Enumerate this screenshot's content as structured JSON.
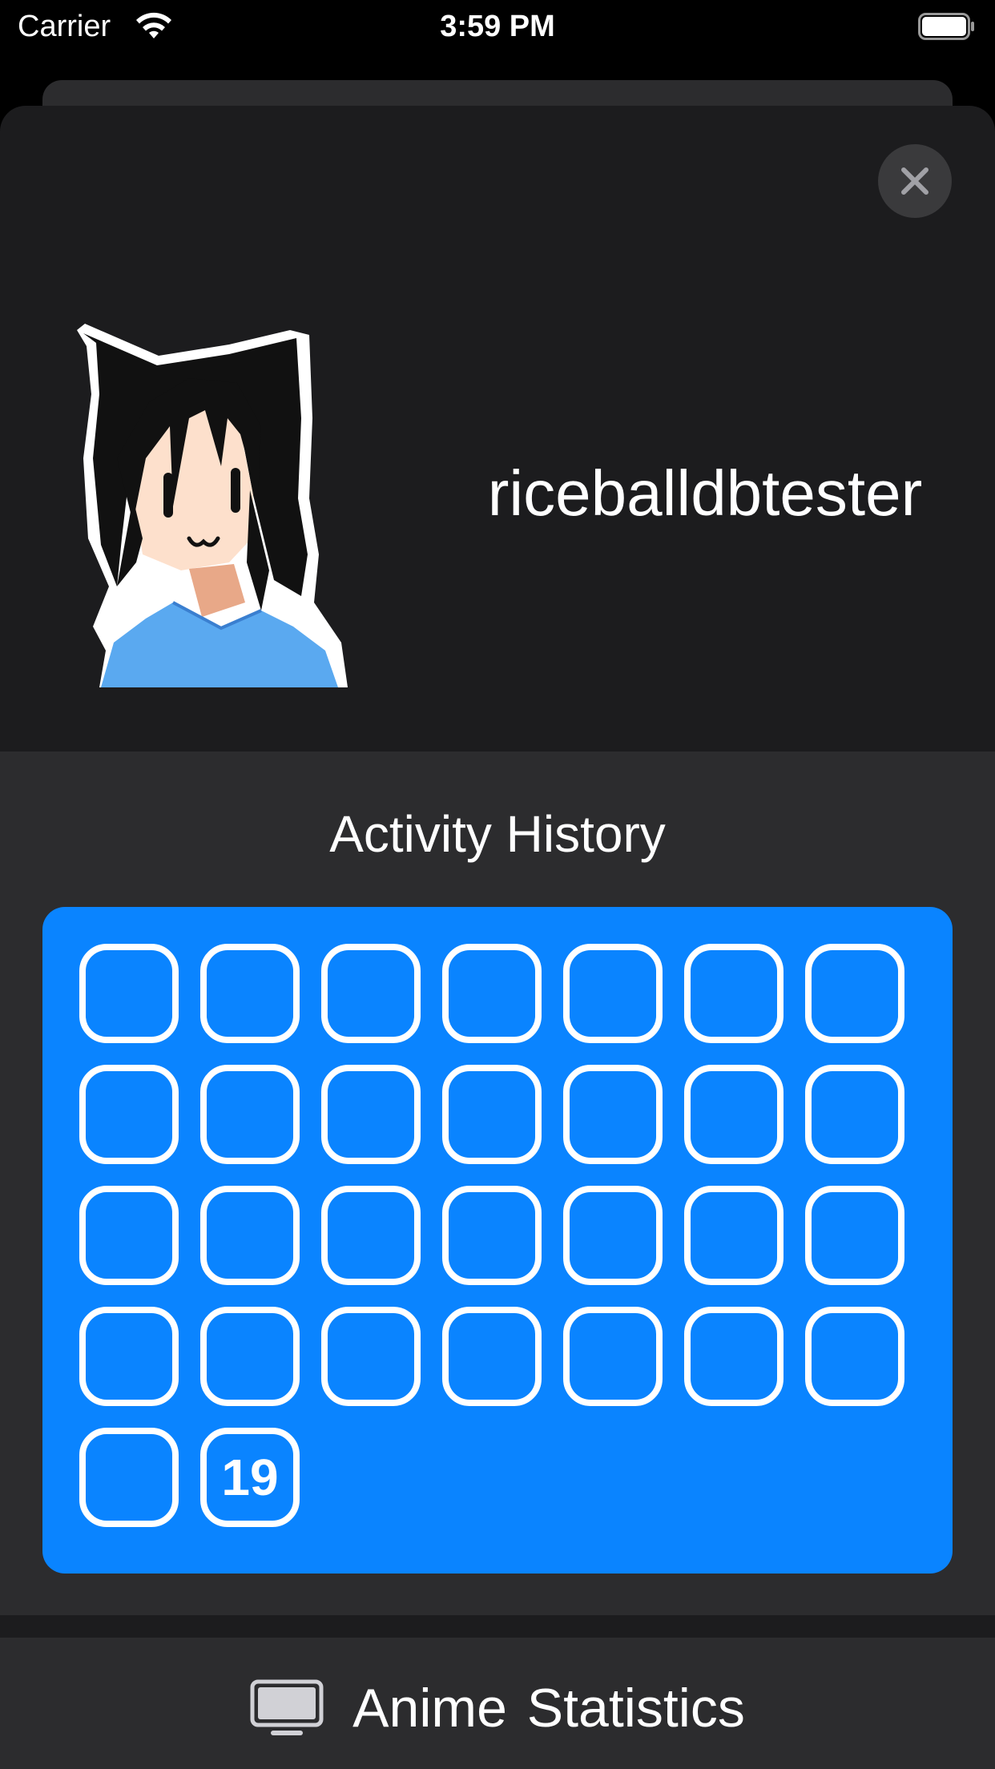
{
  "status_bar": {
    "carrier": "Carrier",
    "time": "3:59 PM"
  },
  "profile": {
    "username": "riceballdbtester",
    "avatar_icon": "anime-cat-girl-avatar"
  },
  "activity": {
    "title": "Activity History",
    "days": [
      "",
      "",
      "",
      "",
      "",
      "",
      "",
      "",
      "",
      "",
      "",
      "",
      "",
      "",
      "",
      "",
      "",
      "",
      "",
      "",
      "",
      "",
      "",
      "",
      "",
      "",
      "",
      "",
      "",
      "19"
    ]
  },
  "anime_statistics": {
    "label": "Anime Statistics",
    "icon": "tv-icon"
  },
  "colors": {
    "accent": "#0a84ff",
    "background": "#000000",
    "sheet": "#1c1c1e",
    "section": "#2c2c2e"
  }
}
